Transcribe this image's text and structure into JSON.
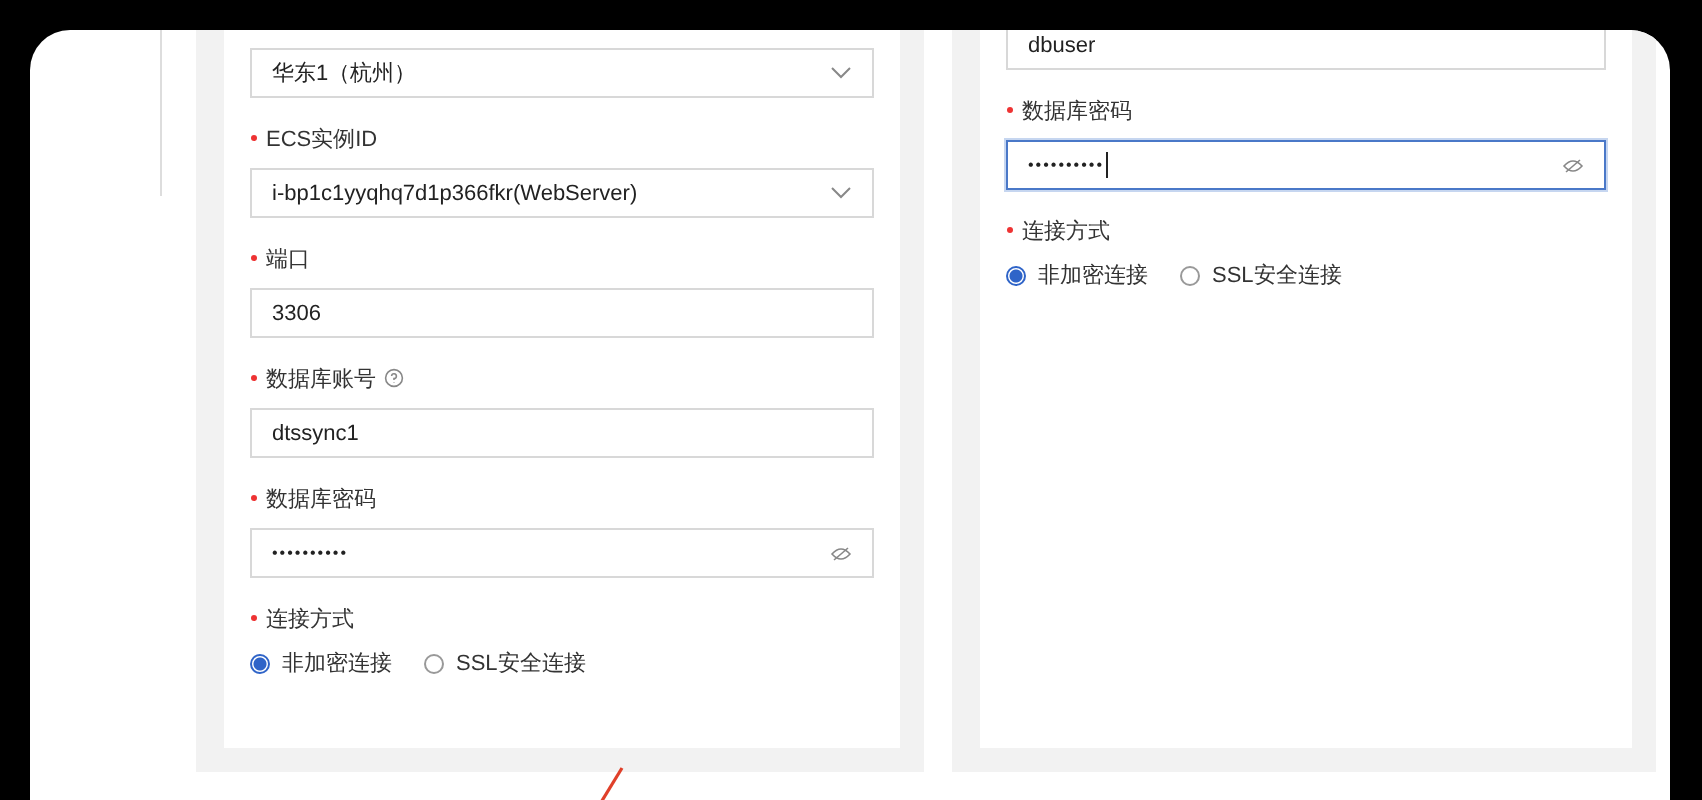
{
  "left_form": {
    "fields": [
      {
        "kind": "select",
        "value": "华东1（杭州）"
      },
      {
        "kind": "select",
        "label": "ECS实例ID",
        "required": true,
        "value": "i-bp1c1yyqhq7d1p366fkr(WebServer)"
      },
      {
        "kind": "input",
        "label": "端口",
        "required": true,
        "value": "3306"
      },
      {
        "kind": "input",
        "label": "数据库账号",
        "required": true,
        "help": true,
        "value": "dtssync1"
      },
      {
        "kind": "password",
        "label": "数据库密码",
        "required": true,
        "value": "••••••••••",
        "focused": false
      },
      {
        "kind": "radio",
        "label": "连接方式",
        "required": true,
        "options": [
          {
            "label": "非加密连接",
            "selected": true
          },
          {
            "label": "SSL安全连接",
            "selected": false
          }
        ]
      }
    ]
  },
  "right_form": {
    "fields": [
      {
        "kind": "input",
        "value": "dbuser"
      },
      {
        "kind": "password",
        "label": "数据库密码",
        "required": true,
        "value": "••••••••••",
        "focused": true
      },
      {
        "kind": "radio",
        "label": "连接方式",
        "required": true,
        "options": [
          {
            "label": "非加密连接",
            "selected": true
          },
          {
            "label": "SSL安全连接",
            "selected": false
          }
        ]
      }
    ]
  }
}
